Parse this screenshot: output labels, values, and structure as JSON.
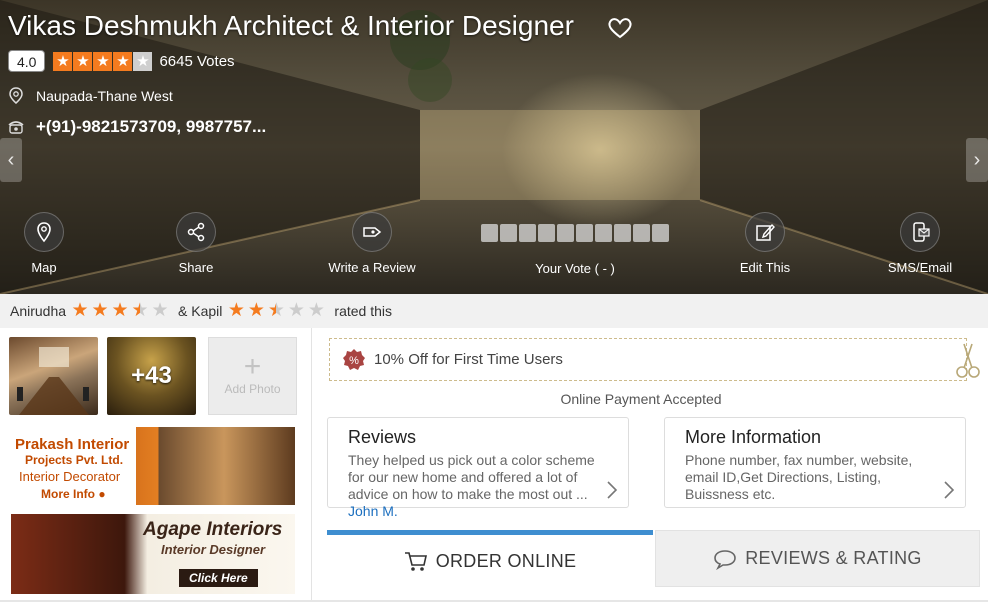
{
  "business": {
    "name": "Vikas Deshmukh Architect & Interior Designer",
    "rating": "4.0",
    "stars_filled": 4,
    "stars_total": 5,
    "votes": "6645 Votes",
    "location": "Naupada-Thane West",
    "phone": "+(91)-9821573709, 9987757..."
  },
  "actions": {
    "map": "Map",
    "share": "Share",
    "write_review": "Write a Review",
    "your_vote": "Your Vote ( - )",
    "edit": "Edit This",
    "sms_email": "SMS/Email"
  },
  "rated": {
    "user1": "Anirudha",
    "user1_rating": 3.5,
    "connector": "& Kapil",
    "user2_rating": 2.5,
    "suffix": "rated this"
  },
  "photos": {
    "more_count": "+43",
    "add_photo": "Add Photo"
  },
  "ads": {
    "ad1_line1": "Prakash Interior",
    "ad1_line2": "Projects Pvt. Ltd.",
    "ad1_line3": "Interior Decorator",
    "ad1_line4": "More Info",
    "ad2_line1": "Agape Interiors",
    "ad2_line2": "Interior Designer",
    "ad2_line3": "Click Here"
  },
  "offer": {
    "text": "10% Off for First Time Users",
    "payment": "Online Payment Accepted"
  },
  "reviews": {
    "title": "Reviews",
    "text": "They helped us pick out a color scheme for our new home and offered a lot of advice on how to make the most out  ...",
    "author": "John M."
  },
  "more_info": {
    "title": "More Information",
    "text": "Phone number, fax number, website, email ID,Get Directions, Listing, Buissness etc."
  },
  "tabs": {
    "order": "ORDER ONLINE",
    "reviews": "REVIEWS & RATING"
  },
  "colors": {
    "accent_orange": "#f47b1f",
    "tab_blue": "#3e8ed0",
    "link_blue": "#1c6fbf"
  }
}
